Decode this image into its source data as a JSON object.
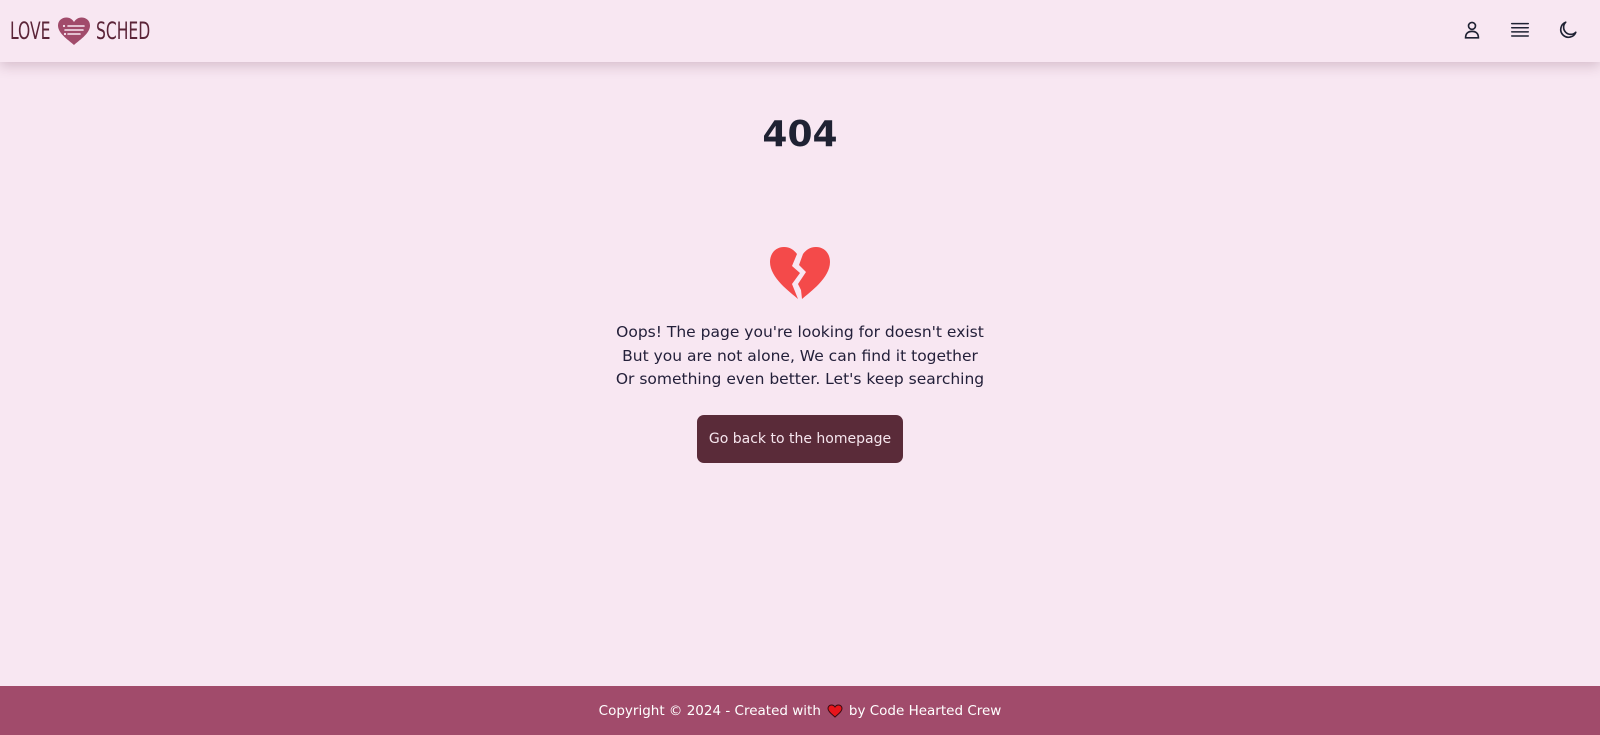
{
  "header": {
    "brand_left": "LOVE",
    "brand_right": "SCHED",
    "icons": [
      "user-icon",
      "menu-lines-icon",
      "moon-icon"
    ]
  },
  "main": {
    "code": "404",
    "icon": "broken-heart-icon",
    "messages": [
      "Oops! The page you're looking for doesn't exist",
      "But you are not alone, We can find it together",
      "Or something even better. Let's keep searching"
    ],
    "button_label": "Go back to the homepage"
  },
  "footer": {
    "text_before": "Copyright © 2024 - Created with",
    "icon": "heart-icon",
    "text_after": "by Code Hearted Crew"
  },
  "colors": {
    "background": "#f8e7f2",
    "brand": "#5b2438",
    "button": "#5a2b39",
    "heart": "#f44a4a",
    "footer": "#a14b6b"
  }
}
